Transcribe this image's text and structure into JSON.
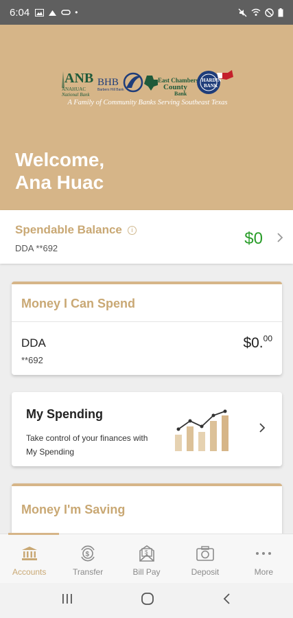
{
  "status_bar": {
    "time": "6:04"
  },
  "brand": {
    "tagline": "A Family of Community Banks Serving Southeast Texas"
  },
  "welcome": {
    "line1": "Welcome,",
    "line2": "Ana Huac"
  },
  "spendable": {
    "label": "Spendable Balance",
    "account": "DDA **692",
    "amount": "$0"
  },
  "money_spend": {
    "title": "Money I Can Spend",
    "account_name": "DDA",
    "account_number": "**692",
    "amount_whole": "$0.",
    "amount_cents": "00"
  },
  "my_spending": {
    "title": "My Spending",
    "description": "Take control of your finances with My Spending"
  },
  "money_saving": {
    "title": "Money I'm Saving"
  },
  "tabs": [
    {
      "label": "Accounts",
      "icon": "bank-icon",
      "active": true
    },
    {
      "label": "Transfer",
      "icon": "transfer-icon",
      "active": false
    },
    {
      "label": "Bill Pay",
      "icon": "bill-pay-icon",
      "active": false
    },
    {
      "label": "Deposit",
      "icon": "camera-icon",
      "active": false
    },
    {
      "label": "More",
      "icon": "more-icon",
      "active": false
    }
  ],
  "colors": {
    "brand": "#d6b588",
    "brand_text": "#c9a874",
    "positive": "#2a9d2a"
  }
}
